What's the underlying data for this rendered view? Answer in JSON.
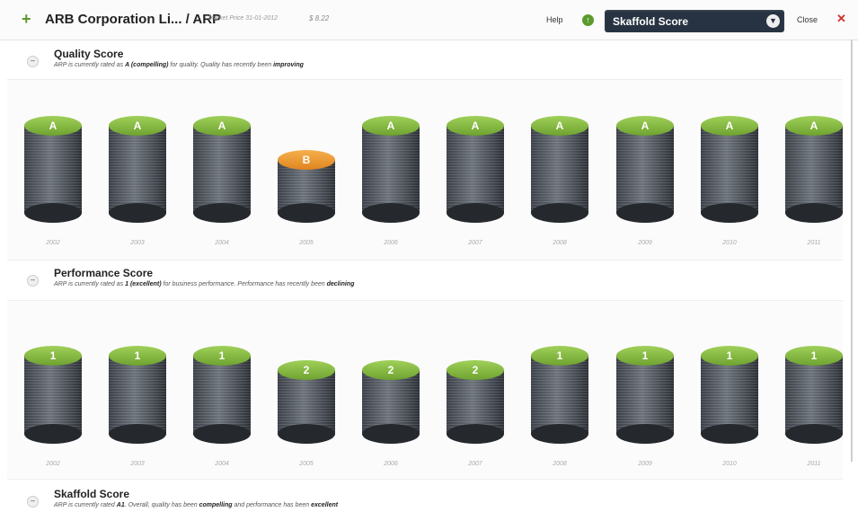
{
  "header": {
    "company": "ARB Corporation Li... / ARP",
    "market_price_label": "Market Price 31-01-2012",
    "price": "$ 8.22",
    "help": "Help",
    "score_select": "Skaffold Score",
    "close": "Close",
    "icons": {
      "add": "plus-icon",
      "info": "up-arrow-icon",
      "dropdown": "chevron-down-icon",
      "close": "close-x-icon",
      "collapse": "minus-icon"
    }
  },
  "years": [
    "2002",
    "2003",
    "2004",
    "2005",
    "2006",
    "2007",
    "2008",
    "2009",
    "2010",
    "2011"
  ],
  "quality": {
    "title": "Quality Score",
    "desc_pre": "ARP is currently rated as ",
    "desc_b1": "A (compelling)",
    "desc_mid": " for quality. Quality has recently been ",
    "desc_b2": "improving",
    "ratings": [
      "A",
      "A",
      "A",
      "B",
      "A",
      "A",
      "A",
      "A",
      "A",
      "A"
    ]
  },
  "performance": {
    "title": "Performance Score",
    "desc_pre": "ARP is currently rated as ",
    "desc_b1": "1 (excellent)",
    "desc_mid": " for business performance. Performance has recently been ",
    "desc_b2": "declining",
    "ratings": [
      "1",
      "1",
      "1",
      "2",
      "2",
      "2",
      "1",
      "1",
      "1",
      "1"
    ]
  },
  "skaffold": {
    "title": "Skaffold Score",
    "desc_pre": "ARP is currently rated ",
    "desc_b1": "A1",
    "desc_mid": ". Overall, quality has been ",
    "desc_b2": "compelling",
    "desc_mid2": " and performance has been ",
    "desc_b3": "excellent"
  },
  "colors": {
    "green": "#7db33c",
    "orange": "#f0a03a",
    "select_bg": "#273342",
    "close_x": "#d0302a"
  }
}
